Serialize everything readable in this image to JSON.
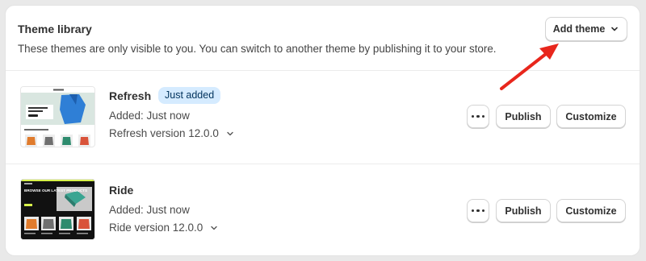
{
  "header": {
    "title": "Theme library",
    "subtitle": "These themes are only visible to you. You can switch to another theme by publishing it to your store.",
    "add_theme_label": "Add theme"
  },
  "themes": [
    {
      "name": "Refresh",
      "badge": "Just added",
      "added": "Added: Just now",
      "version": "Refresh version 12.0.0",
      "publish_label": "Publish",
      "customize_label": "Customize"
    },
    {
      "name": "Ride",
      "added": "Added: Just now",
      "version": "Ride version 12.0.0",
      "publish_label": "Publish",
      "customize_label": "Customize",
      "thumbnail_text": "BROWSE OUR LATEST PRODUCTS"
    }
  ],
  "colors": {
    "badge_bg": "#d5ebff",
    "arrow": "#e8261c",
    "ride_accent": "#d8f24a",
    "refresh_accent": "#2f7fd6"
  },
  "icons": {
    "chevron": "chevron-down-icon",
    "more": "more-horizontal-icon"
  }
}
